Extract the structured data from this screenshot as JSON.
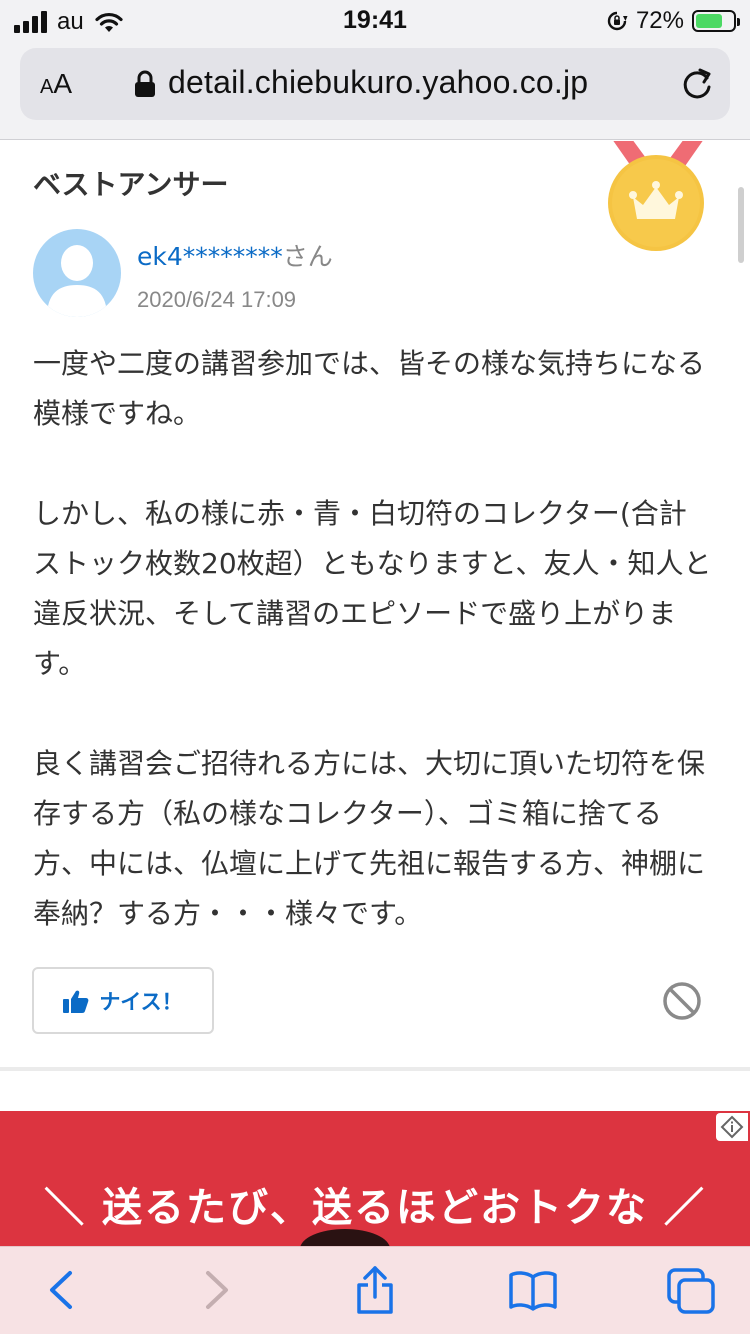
{
  "status_bar": {
    "carrier": "au",
    "time": "19:41",
    "battery_percent": "72%",
    "battery_level": 0.72,
    "battery_color": "#4cd964"
  },
  "browser": {
    "text_size_label": "AA",
    "url": "detail.chiebukuro.yahoo.co.jp"
  },
  "answer": {
    "section_title": "ベストアンサー",
    "user_id": "ek4********",
    "honorific": "さん",
    "posted_at": "2020/6/24 17:09",
    "paragraphs": [
      "一度や二度の講習参加では、皆その様な気持ちになる模様ですね。",
      "しかし、私の様に赤・青・白切符のコレクター(合計ストック枚数20枚超）ともなりますと、友人・知人と違反状況、そして講習のエピソードで盛り上がります。",
      "良く講習会ご招待れる方には、大切に頂いた切符を保存する方（私の様なコレクター）、ゴミ箱に捨てる方、中には、仏壇に上げて先祖に報告する方、神棚に奉納？する方・・・様々です。"
    ],
    "nice_label": "ナイス！"
  },
  "ad": {
    "headline": "＼ 送るたび、送るほどおトクな ／",
    "background_color": "#dc3440"
  },
  "icons": {
    "medal": "medal-crown-icon",
    "back": "back-chevron-icon",
    "forward": "forward-chevron-icon",
    "share": "share-icon",
    "bookmarks": "bookmarks-icon",
    "tabs": "tabs-icon"
  },
  "colors": {
    "link_blue": "#0b6bc6",
    "medal_gold": "#f5c443",
    "ribbon": "#ef6c74",
    "toolbar_icons": "#1a73e8"
  }
}
